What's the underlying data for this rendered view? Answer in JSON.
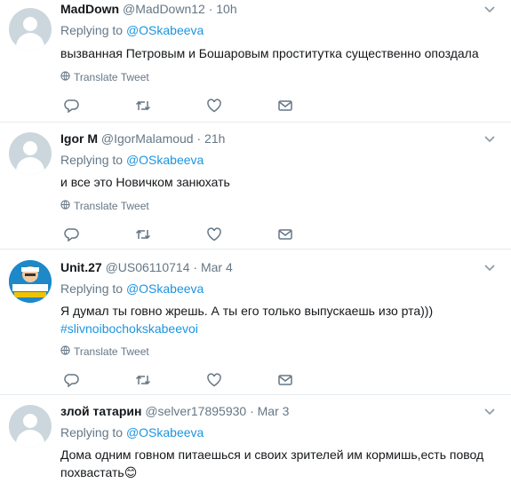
{
  "tweets": [
    {
      "name": "MadDown",
      "handle": "@MadDown12",
      "time": "10h",
      "replying_prefix": "Replying to",
      "replying_to": "@OSkabeeva",
      "text": "вызванная Петровым и Бошаровым проститутка существенно опоздала",
      "hashtag": "",
      "translate": "Translate Tweet"
    },
    {
      "name": "Igor M",
      "handle": "@IgorMalamoud",
      "time": "21h",
      "replying_prefix": "Replying to",
      "replying_to": "@OSkabeeva",
      "text": "и все это Новичком занюхать",
      "hashtag": "",
      "translate": "Translate Tweet"
    },
    {
      "name": "Unit.27",
      "handle": "@US06110714",
      "time": "Mar 4",
      "replying_prefix": "Replying to",
      "replying_to": "@OSkabeeva",
      "text": "Я думал ты говно жрешь. А ты его только выпускаешь изо рта)))",
      "hashtag": "#slivnoibochokskabeevoi",
      "translate": "Translate Tweet"
    },
    {
      "name": "злой татарин",
      "handle": "@selver17895930",
      "time": "Mar 3",
      "replying_prefix": "Replying to",
      "replying_to": "@OSkabeeva",
      "text": "Дома одним говном питаешься и своих зрителей им кормишь,есть повод похвастать😊",
      "hashtag": "",
      "translate": ""
    }
  ],
  "separator": "·",
  "icons": {
    "caret": "chevron-down-icon",
    "globe": "globe-icon",
    "reply": "reply-icon",
    "retweet": "retweet-icon",
    "like": "like-icon",
    "message": "direct-message-icon"
  },
  "colors": {
    "link": "#1b95e0",
    "secondary_text": "#657786",
    "divider": "#e6ecf0"
  }
}
